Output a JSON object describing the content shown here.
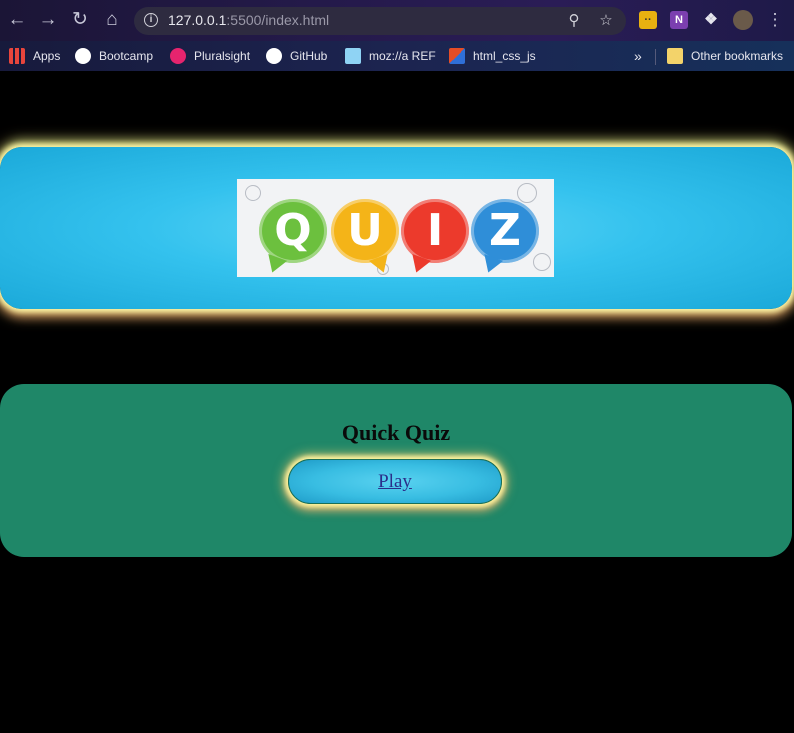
{
  "browser": {
    "url_host": "127.0.0.1",
    "url_rest": ":5500/index.html",
    "bookmarks": [
      {
        "label": "Apps",
        "color": "#e8453c"
      },
      {
        "label": "Bootcamp",
        "color": "#ffffff"
      },
      {
        "label": "Pluralsight",
        "color": "#e6246e"
      },
      {
        "label": "GitHub",
        "color": "#ffffff"
      },
      {
        "label": "moz://a REF",
        "color": "#8fd3f4"
      },
      {
        "label": "html_css_js",
        "color": "#e54d26"
      }
    ],
    "other_bookmarks": "Other bookmarks"
  },
  "hero": {
    "logo_letters": [
      "Q",
      "U",
      "I",
      "Z"
    ]
  },
  "quiz": {
    "title": "Quick Quiz",
    "play_label": "Play"
  },
  "colors": {
    "page_bg": "#000000",
    "hero_bg": "#34c2ee",
    "panel_bg": "#1f8768",
    "glow": "#fff6a0"
  }
}
